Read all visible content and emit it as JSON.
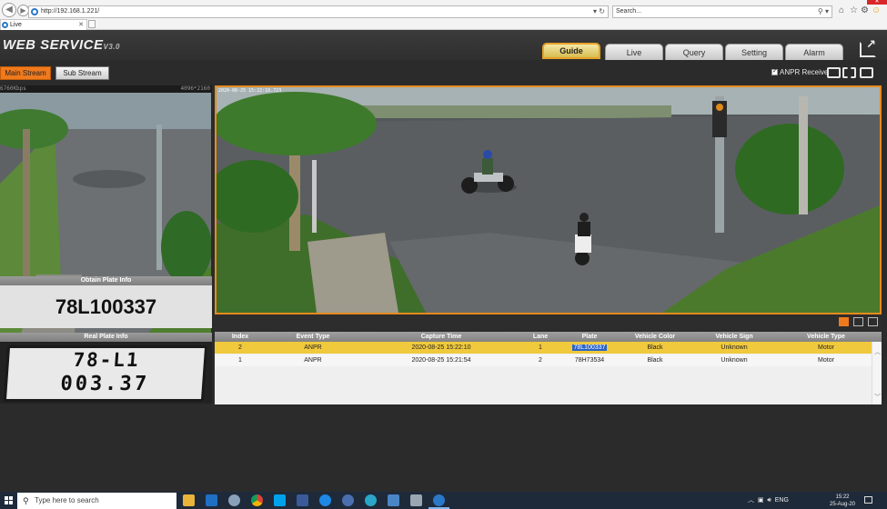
{
  "browser": {
    "url": "http://192.168.1.221/",
    "search_placeholder": "Search...",
    "tab_title": "Live"
  },
  "app": {
    "brand": "WEB  SERVICE",
    "version": "V3.0",
    "nav_tabs": [
      "Guide",
      "Live",
      "Query",
      "Setting",
      "Alarm"
    ],
    "active_tab": "Guide"
  },
  "toolbar": {
    "main_stream": "Main Stream",
    "sub_stream": "Sub Stream",
    "anpr_receive": "ANPR Receive",
    "anpr_checked": true
  },
  "small_video": {
    "bitrate": "6760Kbps",
    "resolution": "4096*2160"
  },
  "main_video": {
    "timestamp": "2020-08-25 15:22:10.723"
  },
  "obtain_plate": {
    "title": "Obtain Plate Info",
    "value": "78L100337"
  },
  "real_plate": {
    "title": "Real Plate Info",
    "line1": "78-L1",
    "line2": "003.37"
  },
  "table": {
    "columns": [
      "Index",
      "Event Type",
      "Capture Time",
      "Lane",
      "Plate",
      "Vehicle Color",
      "Vehicle Sign",
      "Vehicle Type"
    ],
    "rows": [
      {
        "index": "2",
        "event": "ANPR",
        "time": "2020-08-25 15:22:10",
        "lane": "1",
        "plate": "78L100337",
        "color": "Black",
        "sign": "Unknown",
        "type": "Motor",
        "selected": true
      },
      {
        "index": "1",
        "event": "ANPR",
        "time": "2020-08-25 15:21:54",
        "lane": "2",
        "plate": "78H73534",
        "color": "Black",
        "sign": "Unknown",
        "type": "Motor",
        "selected": false
      }
    ]
  },
  "taskbar": {
    "search_placeholder": "Type here to search",
    "language": "ENG",
    "time": "15:22",
    "date": "25-Aug-20"
  },
  "colors": {
    "accent_orange": "#ef7a1e",
    "selected_row": "#f0c93d",
    "header_bg": "#333333"
  }
}
